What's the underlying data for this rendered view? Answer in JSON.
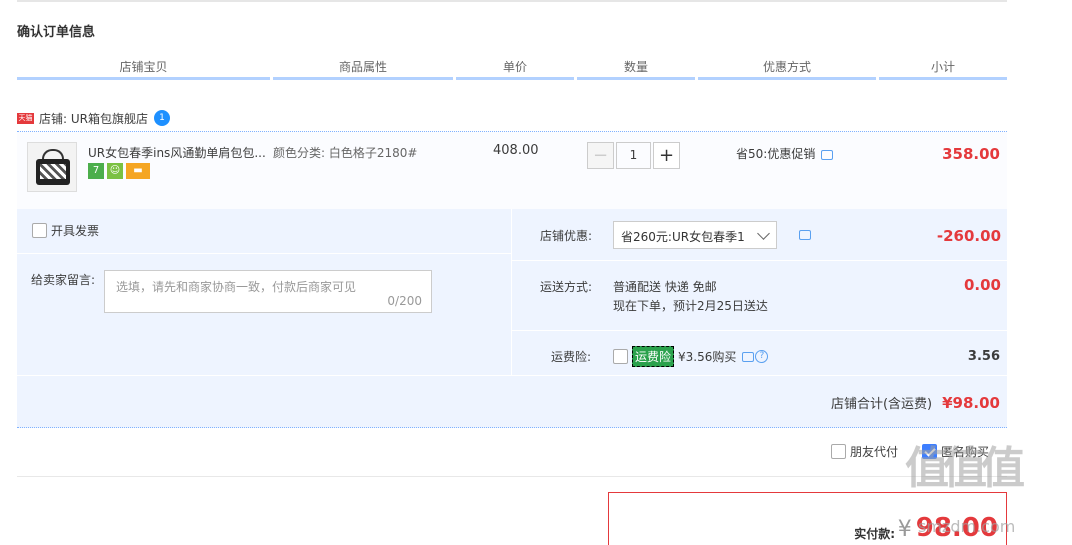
{
  "title": "确认订单信息",
  "columns": [
    "店铺宝贝",
    "商品属性",
    "单价",
    "数量",
    "优惠方式",
    "小计"
  ],
  "shop": {
    "badge": "天猫",
    "name": "店铺: UR箱包旗舰店",
    "chat_badge": "1"
  },
  "item": {
    "name": "UR女包春季ins风通勤单肩包包...",
    "badges": [
      "7",
      "",
      ""
    ],
    "attr": "颜色分类: 白色格子2180#",
    "price": "408.00",
    "qty": "1",
    "promo": "省50:优惠促销",
    "subtotal": "358.00"
  },
  "invoice_label": "开具发票",
  "memo": {
    "label": "给卖家留言:",
    "placeholder": "选填，请先和商家协商一致，付款后商家可见",
    "count": "0/200"
  },
  "discount": {
    "label": "店铺优惠:",
    "selected": "省260元:UR女包春季1",
    "value": "-260.00"
  },
  "shipping": {
    "label": "运送方式:",
    "line1": "普通配送 快递 免邮",
    "line2": "现在下单，预计2月25日送达",
    "value": "0.00"
  },
  "insurance": {
    "label": "运费险:",
    "tag": "运费险",
    "text": "¥3.56购买",
    "value": "3.56",
    "help": "?"
  },
  "shop_total": {
    "label": "店铺合计(含运费)",
    "value": "¥98.00"
  },
  "options": {
    "friend_pay": "朋友代付",
    "anonymous": "匿名购买",
    "anonymous_checked": true
  },
  "pay": {
    "label": "实付款:",
    "currency": "¥",
    "amount": "98.00"
  },
  "watermark": {
    "main": "值值值",
    "sub": "smzdm.com"
  }
}
